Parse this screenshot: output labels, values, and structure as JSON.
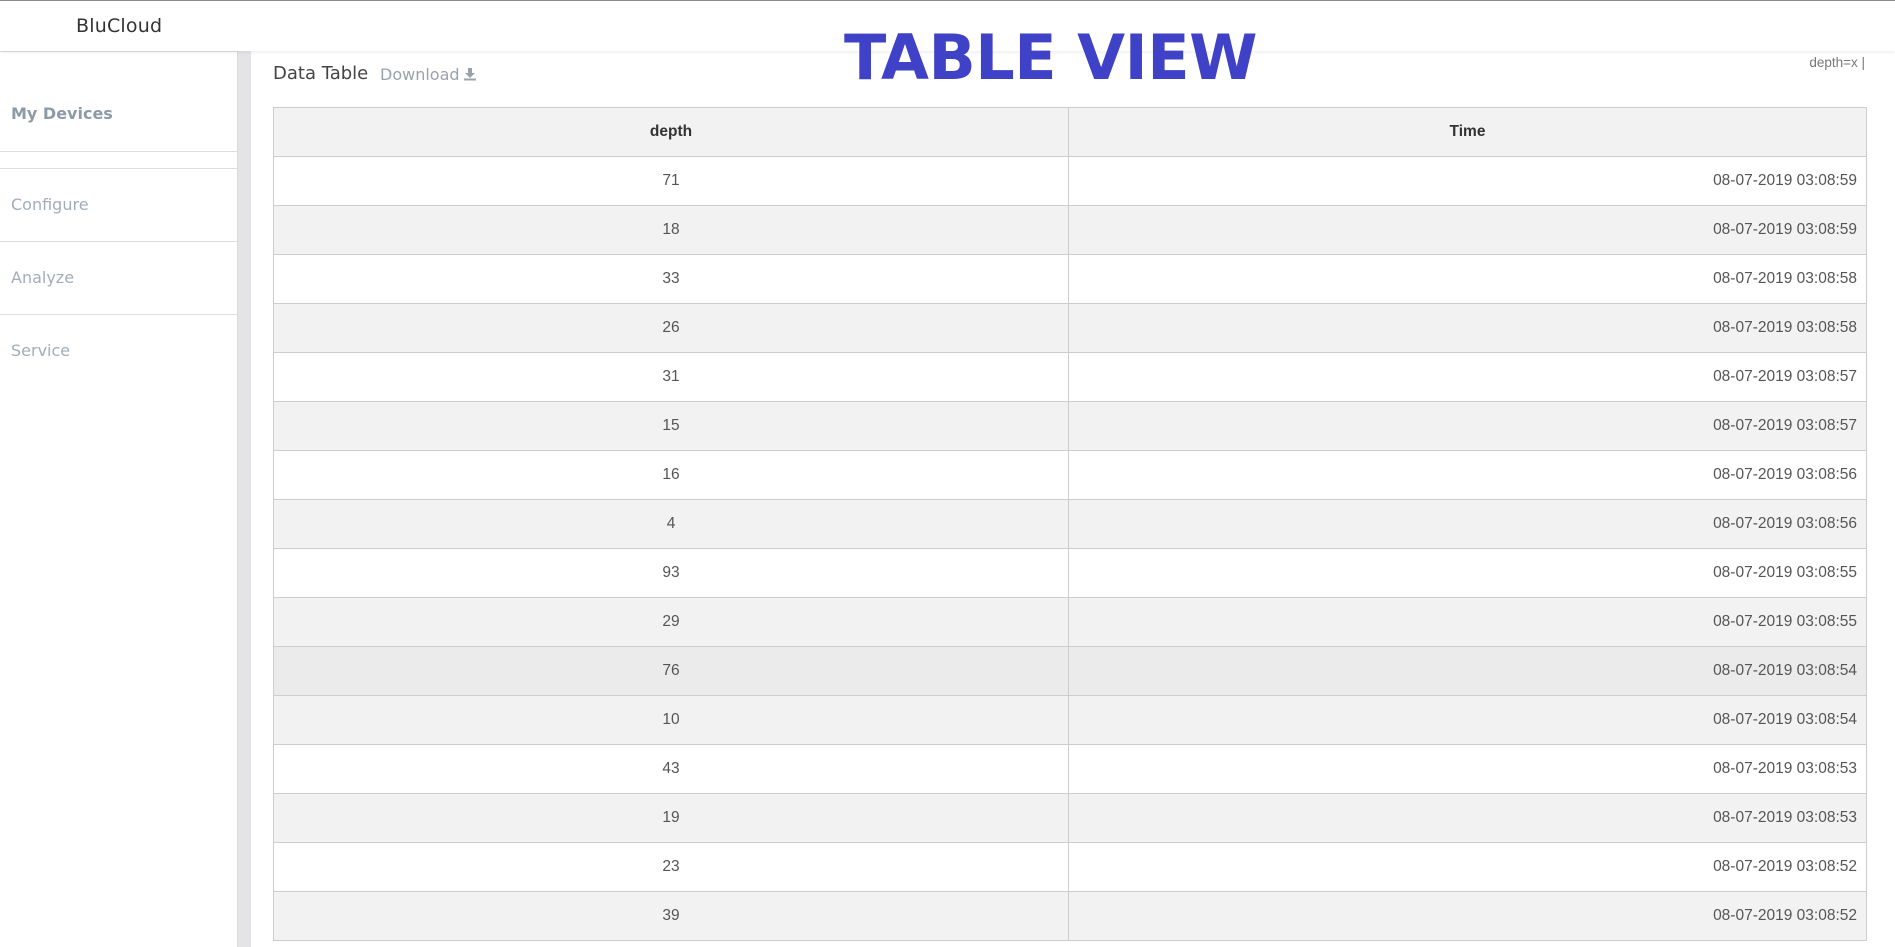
{
  "app": {
    "brand": "BluCloud"
  },
  "banner": "TABLE VIEW",
  "sidebar": {
    "items": [
      {
        "label": "My Devices",
        "active": true
      },
      {
        "label": "Configure"
      },
      {
        "label": "Analyze"
      },
      {
        "label": "Service"
      }
    ]
  },
  "panel": {
    "title": "Data Table",
    "download_label": "Download",
    "download_icon": "download-icon",
    "filter_text": "depth=x |"
  },
  "table": {
    "headers": [
      "depth",
      "Time"
    ],
    "rows": [
      [
        "71",
        "08-07-2019 03:08:59"
      ],
      [
        "18",
        "08-07-2019 03:08:59"
      ],
      [
        "33",
        "08-07-2019 03:08:58"
      ],
      [
        "26",
        "08-07-2019 03:08:58"
      ],
      [
        "31",
        "08-07-2019 03:08:57"
      ],
      [
        "15",
        "08-07-2019 03:08:57"
      ],
      [
        "16",
        "08-07-2019 03:08:56"
      ],
      [
        "4",
        "08-07-2019 03:08:56"
      ],
      [
        "93",
        "08-07-2019 03:08:55"
      ],
      [
        "29",
        "08-07-2019 03:08:55"
      ],
      [
        "76",
        "08-07-2019 03:08:54"
      ],
      [
        "10",
        "08-07-2019 03:08:54"
      ],
      [
        "43",
        "08-07-2019 03:08:53"
      ],
      [
        "19",
        "08-07-2019 03:08:53"
      ],
      [
        "23",
        "08-07-2019 03:08:52"
      ],
      [
        "39",
        "08-07-2019 03:08:52"
      ]
    ]
  },
  "colors": {
    "banner": "#3f41c6",
    "sidebar_text": "#a3adb8"
  }
}
